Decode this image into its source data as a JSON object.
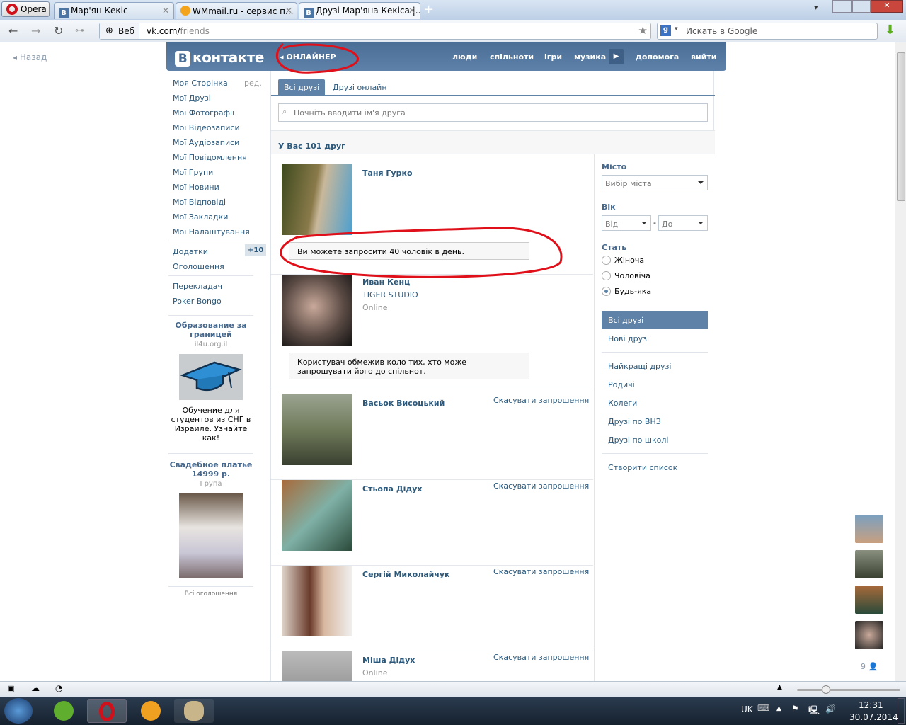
{
  "browser": {
    "menu_label": "Opera",
    "tabs": [
      {
        "label": "Мар'ян Кекіс",
        "icon": "vk-icon"
      },
      {
        "label": "WMmail.ru - сервис п...",
        "icon": "wmmail-icon"
      },
      {
        "label": "Друзі Мар'яна Кекіса |...",
        "icon": "vk-icon",
        "active": true
      }
    ],
    "address_mode": "Веб",
    "url_host": "vk.com/",
    "url_path": "friends",
    "search_placeholder": "Искать в Google"
  },
  "page": {
    "back_label": "Назад",
    "header": {
      "logo": "контакте",
      "logo_letter": "В",
      "player": "ОНЛАЙНЕР",
      "nav": [
        "люди",
        "спільноти",
        "ігри",
        "музика",
        "допомога",
        "вийти"
      ]
    },
    "left_menu": {
      "items": [
        "Моя Сторінка",
        "Мої Друзі",
        "Мої Фотографії",
        "Мої Відеозаписи",
        "Мої Аудіозаписи",
        "Мої Повідомлення",
        "Мої Групи",
        "Мої Новини",
        "Мої Відповіді",
        "Мої Закладки",
        "Мої Налаштування"
      ],
      "edit_label": "ред.",
      "extra": [
        "Додатки",
        "Оголошення"
      ],
      "apps_badge": "+10",
      "apps": [
        "Перекладач",
        "Poker Bongo"
      ]
    },
    "ads": [
      {
        "title": "Образование за границей",
        "domain": "il4u.org.il",
        "text": "Обучение для студентов из СНГ в Израиле. Узнайте как!"
      },
      {
        "title": "Свадебное платье 14999 р.",
        "domain": "Група"
      }
    ],
    "all_ads_label": "Всі оголошення",
    "friends": {
      "tabs": [
        "Всі друзі",
        "Друзі онлайн"
      ],
      "search_placeholder": "Почніть вводити ім'я друга",
      "count_label": "У Вас 101 друг",
      "cancel_label": "Скасувати запрошення",
      "list": [
        {
          "name": "Таня Гурко"
        },
        {
          "name": "Иван Кенц",
          "sub": "TIGER STUDIO",
          "status": "Online"
        },
        {
          "name": "Васьок Висоцький"
        },
        {
          "name": "Стьопа Дідух"
        },
        {
          "name": "Сергій Миколайчук"
        },
        {
          "name": "Міша Дідух",
          "status": "Online"
        }
      ],
      "notices": [
        "Ви можете запросити 40 чоловік в день.",
        "Користувач обмежив коло тих, хто може запрошувати його до спільнот."
      ]
    },
    "filters": {
      "city_label": "Місто",
      "city_value": "Вибір міста",
      "age_label": "Вік",
      "age_from": "Від",
      "age_to": "До",
      "age_dash": "-",
      "gender_label": "Стать",
      "genders": [
        "Жіноча",
        "Чоловіча",
        "Будь-яка"
      ],
      "gender_selected": 2,
      "lists": [
        "Всі друзі",
        "Нові друзі"
      ],
      "lists2": [
        "Найкращі друзі",
        "Родичі",
        "Колеги",
        "Друзі по ВНЗ",
        "Друзі по школі"
      ],
      "create_list": "Створити список"
    },
    "chat_online_count": "9"
  },
  "taskbar": {
    "lang": "UK",
    "time": "12:31",
    "date": "30.07.2014"
  },
  "colors": {
    "vk_blue": "#5e82a8",
    "link": "#2b587a",
    "annotation": "#e0101a"
  }
}
